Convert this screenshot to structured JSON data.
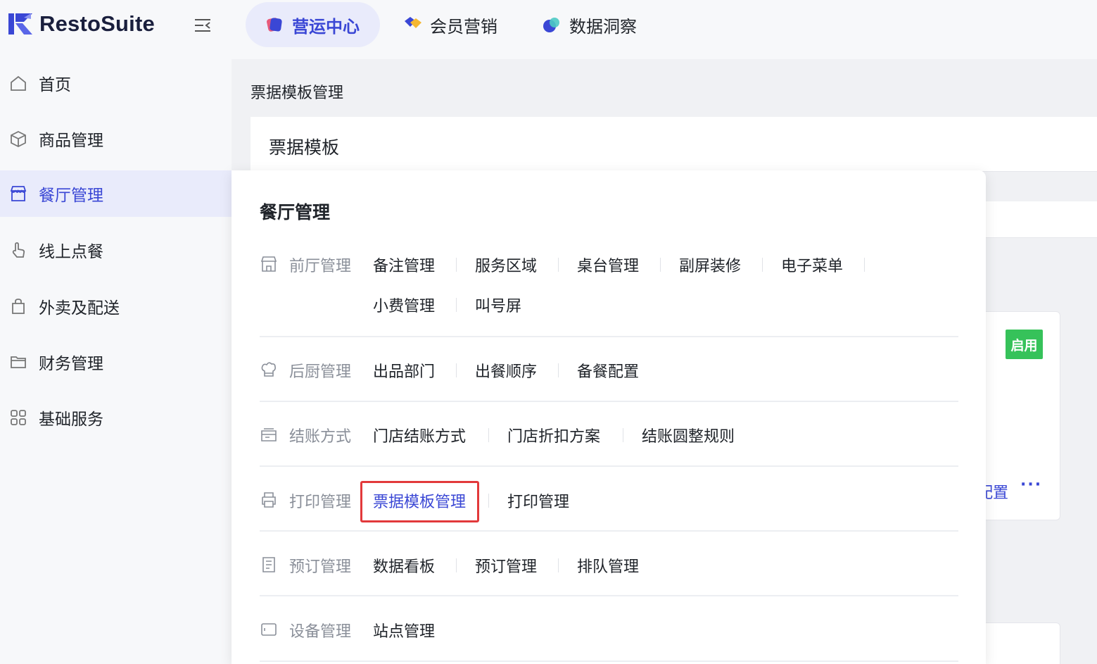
{
  "app": {
    "name": "RestoSuite"
  },
  "top_tabs": [
    {
      "label": "营运中心",
      "active": true,
      "icon": "ops-center-icon"
    },
    {
      "label": "会员营销",
      "active": false,
      "icon": "member-marketing-icon"
    },
    {
      "label": "数据洞察",
      "active": false,
      "icon": "data-insight-icon"
    }
  ],
  "sidebar": {
    "items": [
      {
        "label": "首页",
        "icon": "home-icon"
      },
      {
        "label": "商品管理",
        "icon": "box-icon"
      },
      {
        "label": "餐厅管理",
        "icon": "store-icon",
        "active": true
      },
      {
        "label": "线上点餐",
        "icon": "tap-hand-icon"
      },
      {
        "label": "外卖及配送",
        "icon": "shopping-bag-icon"
      },
      {
        "label": "财务管理",
        "icon": "folder-icon"
      },
      {
        "label": "基础服务",
        "icon": "grid-icon"
      }
    ]
  },
  "main": {
    "page_title": "票据模板管理",
    "card_title": "票据模板",
    "status_badge": "启用",
    "config_link": "配置",
    "more_label": "···"
  },
  "mega_menu": {
    "title": "餐厅管理",
    "groups": [
      {
        "label": "前厅管理",
        "icon": "storefront-icon",
        "links": [
          "备注管理",
          "服务区域",
          "桌台管理",
          "副屏装修",
          "电子菜单",
          "小费管理",
          "叫号屏"
        ]
      },
      {
        "label": "后厨管理",
        "icon": "chef-hat-icon",
        "links": [
          "出品部门",
          "出餐顺序",
          "备餐配置"
        ]
      },
      {
        "label": "结账方式",
        "icon": "checkout-icon",
        "links": [
          "门店结账方式",
          "门店折扣方案",
          "结账圆整规则"
        ]
      },
      {
        "label": "打印管理",
        "icon": "printer-icon",
        "links": [
          "票据模板管理",
          "打印管理"
        ]
      },
      {
        "label": "预订管理",
        "icon": "clipboard-icon",
        "links": [
          "数据看板",
          "预订管理",
          "排队管理"
        ]
      },
      {
        "label": "设备管理",
        "icon": "device-icon",
        "links": [
          "站点管理"
        ]
      }
    ]
  },
  "colors": {
    "accent": "#3a47d5",
    "active_bg": "#e9ebfb",
    "badge_green": "#36c25a",
    "highlight_red": "#e2393b"
  }
}
